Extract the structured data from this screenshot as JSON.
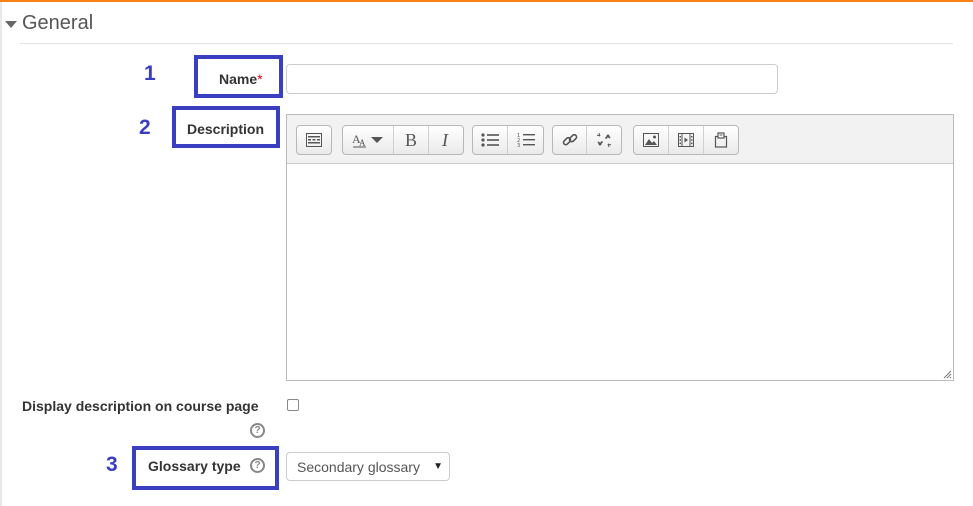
{
  "section": {
    "title": "General"
  },
  "fields": {
    "name": {
      "label": "Name",
      "required_mark": "*",
      "value": ""
    },
    "description": {
      "label": "Description"
    },
    "display_description": {
      "label": "Display description on course page",
      "checked": false
    },
    "glossary_type": {
      "label": "Glossary type",
      "selected": "Secondary glossary"
    }
  },
  "help_glyph": "?",
  "callouts": [
    "1",
    "2",
    "3"
  ],
  "toolbar_icons": [
    "show-more-buttons-icon",
    "font-size-icon",
    "bold-icon",
    "italic-icon",
    "unordered-list-icon",
    "ordered-list-icon",
    "link-icon",
    "unlink-icon",
    "insert-image-icon",
    "insert-media-icon",
    "manage-files-icon"
  ],
  "colors": {
    "accent": "#f98012",
    "callout": "#3a3fc2",
    "required": "#d9001a"
  }
}
